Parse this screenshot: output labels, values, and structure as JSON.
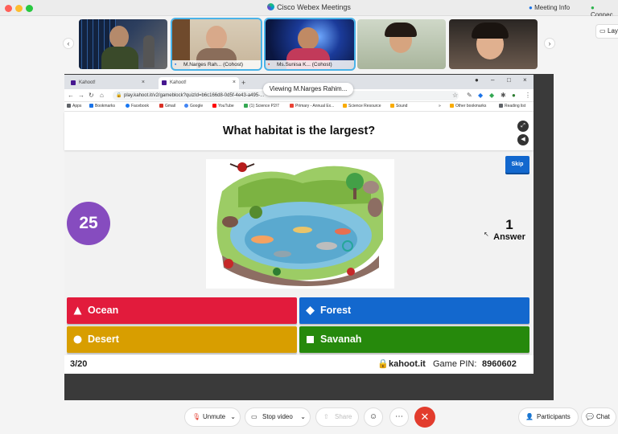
{
  "webex": {
    "window_title": "Cisco Webex Meetings",
    "meeting_info": "Meeting Info",
    "connection_label": "Connec",
    "layout_label": "Lay"
  },
  "participants": [
    {
      "name": ""
    },
    {
      "name": "M.Narges Rah...",
      "role": "(Cohost)"
    },
    {
      "name": "Ms.Sunisa K...",
      "role": "(Cohost)"
    },
    {
      "name": ""
    },
    {
      "name": ""
    }
  ],
  "share": {
    "viewing_label": "Viewing M.Narges Rahim..."
  },
  "browser": {
    "tabs": [
      {
        "label": "Kahoot!"
      },
      {
        "label": "Kahoot!"
      }
    ],
    "new_tab": "+",
    "url": "play.kahoot.it/v2/gameblock?quizId=b6c166d8-0d5f-4e43-a495-...",
    "bookmarks": [
      {
        "label": "Apps",
        "color": "#5f6368"
      },
      {
        "label": "Bookmarks",
        "color": "#1a73e8"
      },
      {
        "label": "Facebook",
        "color": "#1877f2"
      },
      {
        "label": "Gmail",
        "color": "#d93025"
      },
      {
        "label": "Google",
        "color": "#4285f4"
      },
      {
        "label": "YouTube",
        "color": "#ff0000"
      },
      {
        "label": "(1) Science P2/7",
        "color": "#34a853"
      },
      {
        "label": "Primary - Annual Ex...",
        "color": "#ea4335"
      },
      {
        "label": "Science Resource",
        "color": "#f9ab00"
      },
      {
        "label": "Sound",
        "color": "#f9ab00"
      },
      {
        "label": "Other bookmarks",
        "color": "#f9ab00"
      },
      {
        "label": "Reading list",
        "color": "#5f6368"
      }
    ]
  },
  "kahoot": {
    "question": "What habitat is the largest?",
    "skip_label": "Skip",
    "timer": "25",
    "answers_count": "1",
    "answers_label": "Answer",
    "options": [
      {
        "label": "Ocean",
        "color": "#e21b3c",
        "shape": "triangle-icon"
      },
      {
        "label": "Forest",
        "color": "#1368ce",
        "shape": "diamond-icon"
      },
      {
        "label": "Desert",
        "color": "#d89e00",
        "shape": "circle-icon"
      },
      {
        "label": "Savanah",
        "color": "#26890c",
        "shape": "square-icon"
      }
    ],
    "progress": "3/20",
    "site": "kahoot.it",
    "game_pin_label": "Game PIN:",
    "game_pin": "8960602"
  },
  "controls": {
    "unmute": "Unmute",
    "stop_video": "Stop video",
    "share": "Share",
    "participants": "Participants",
    "chat": "Chat"
  }
}
